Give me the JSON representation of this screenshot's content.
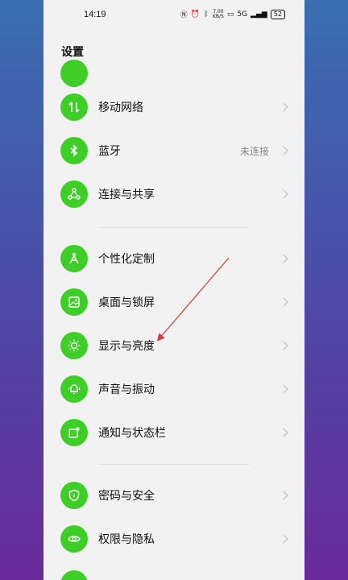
{
  "status": {
    "time": "14:19",
    "speed_value": "7.00",
    "speed_unit": "KB/S",
    "signal": "5G",
    "battery": "52"
  },
  "page": {
    "title": "设置"
  },
  "items": [
    {
      "label": "移动网络",
      "icon": "mobile-data-icon",
      "value": ""
    },
    {
      "label": "蓝牙",
      "icon": "bluetooth-icon",
      "value": "未连接"
    },
    {
      "label": "连接与共享",
      "icon": "share-icon",
      "value": ""
    },
    {
      "label": "个性化定制",
      "icon": "personalize-icon",
      "value": ""
    },
    {
      "label": "桌面与锁屏",
      "icon": "wallpaper-icon",
      "value": ""
    },
    {
      "label": "显示与亮度",
      "icon": "brightness-icon",
      "value": ""
    },
    {
      "label": "声音与振动",
      "icon": "bell-icon",
      "value": ""
    },
    {
      "label": "通知与状态栏",
      "icon": "notification-icon",
      "value": ""
    },
    {
      "label": "密码与安全",
      "icon": "shield-icon",
      "value": ""
    },
    {
      "label": "权限与隐私",
      "icon": "privacy-icon",
      "value": ""
    }
  ],
  "colors": {
    "accent": "#3fce28",
    "annotation_arrow": "#d23a3a"
  }
}
